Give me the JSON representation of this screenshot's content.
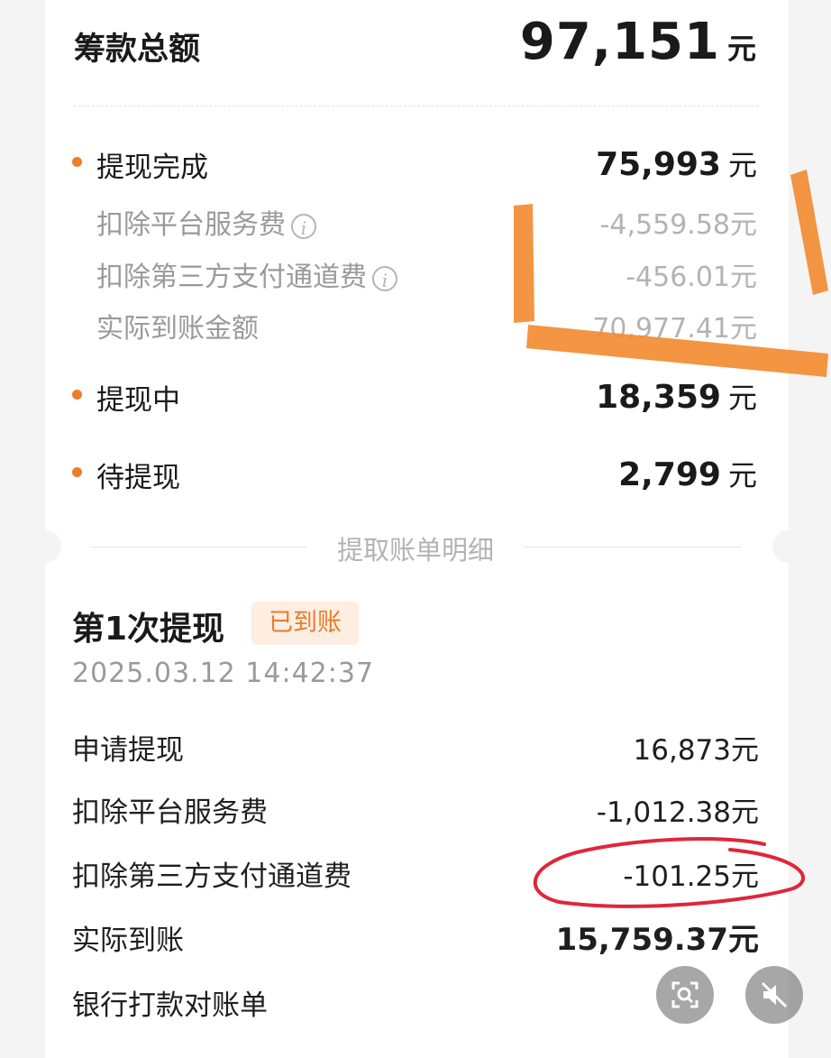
{
  "summary": {
    "total_label": "筹款总额",
    "total_amount": "97,151",
    "unit": "元"
  },
  "withdrawn": {
    "label": "提现完成",
    "amount": "75,993",
    "platform_fee_label": "扣除平台服务费",
    "platform_fee": "-4,559.58元",
    "channel_fee_label": "扣除第三方支付通道费",
    "channel_fee": "-456.01元",
    "received_label": "实际到账金额",
    "received": "70,977.41元"
  },
  "in_progress": {
    "label": "提现中",
    "amount": "18,359"
  },
  "pending": {
    "label": "待提现",
    "amount": "2,799"
  },
  "section_title": "提取账单明细",
  "withdrawal_1": {
    "title": "第1次提现",
    "badge": "已到账",
    "time": "2025.03.12 14:42:37",
    "rows": [
      {
        "label": "申请提现",
        "amount": "16,873元"
      },
      {
        "label": "扣除平台服务费",
        "amount": "-1,012.38元"
      },
      {
        "label": "扣除第三方支付通道费",
        "amount": "-101.25元"
      },
      {
        "label": "实际到账",
        "amount": "15,759.37元"
      }
    ],
    "bank_statement_label": "银行打款对账单"
  },
  "icons": {
    "info": "info-icon",
    "scan": "scan-icon",
    "mute": "mute-icon",
    "bullet_color": "#ee7d2a",
    "highlight_orange": "#f28a2e",
    "circle_red": "#e0263a"
  }
}
